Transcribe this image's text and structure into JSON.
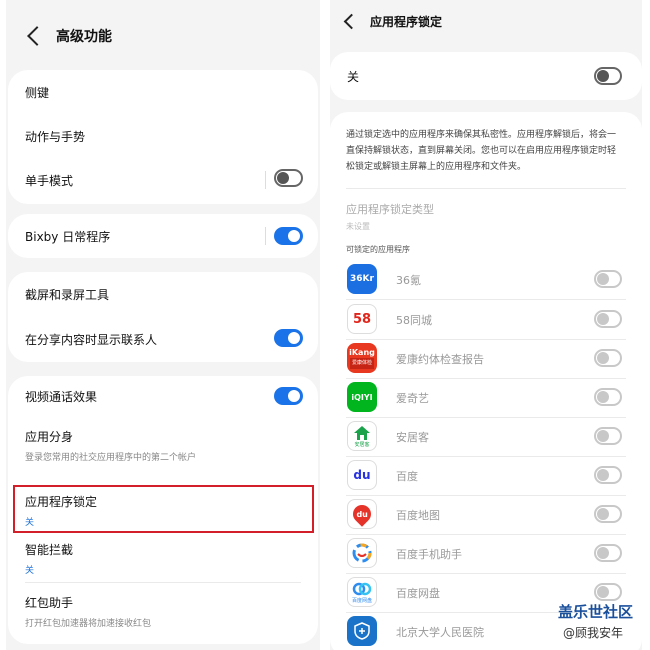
{
  "left": {
    "title": "高级功能",
    "items": {
      "side_key": "侧键",
      "motions": "动作与手势",
      "one_hand": "单手模式",
      "bixby": "Bixby 日常程序",
      "screenshot": "截屏和录屏工具",
      "share_contacts": "在分享内容时显示联系人",
      "video_effects": "视频通话效果",
      "dual_app": "应用分身",
      "dual_app_sub": "登录您常用的社交应用程序中的第二个帐户",
      "app_lock": "应用程序锁定",
      "app_lock_sub": "关",
      "intercept": "智能拦截",
      "intercept_sub": "关",
      "red_packet": "红包助手",
      "red_packet_sub": "打开红包加速器将加速接收红包"
    },
    "toggles": {
      "one_hand": false,
      "bixby": true,
      "share_contacts": true,
      "video_effects": true
    }
  },
  "right": {
    "title": "应用程序锁定",
    "master_label": "关",
    "description": "通过锁定选中的应用程序来确保其私密性。应用程序解锁后，将会一直保持解锁状态，直到屏幕关闭。您也可以在启用应用程序锁定时轻松锁定或解锁主屏幕上的应用程序和文件夹。",
    "lock_type_label": "应用程序锁定类型",
    "lock_type_value": "未设置",
    "lockable_header": "可锁定的应用程序",
    "apps": [
      "36氪",
      "58同城",
      "爱康约体检查报告",
      "爱奇艺",
      "安居客",
      "百度",
      "百度地图",
      "百度手机助手",
      "百度网盘",
      "北京大学人民医院"
    ],
    "icon_texts": {
      "kr": "36Kr",
      "wuba": "58",
      "ikang": "iKang",
      "ikang_sub": "爱康体检",
      "iqiyi": "iQIYI",
      "anjuke": "安居客",
      "baidu": "du",
      "baidumap": "du",
      "netdisk": "百度网盘"
    }
  },
  "watermark": {
    "line1": "盖乐世社区",
    "line2": "@顾我安年"
  },
  "colors": {
    "accent": "#1a73e8",
    "highlight": "#d21f2a",
    "link": "#1a6fd8"
  }
}
